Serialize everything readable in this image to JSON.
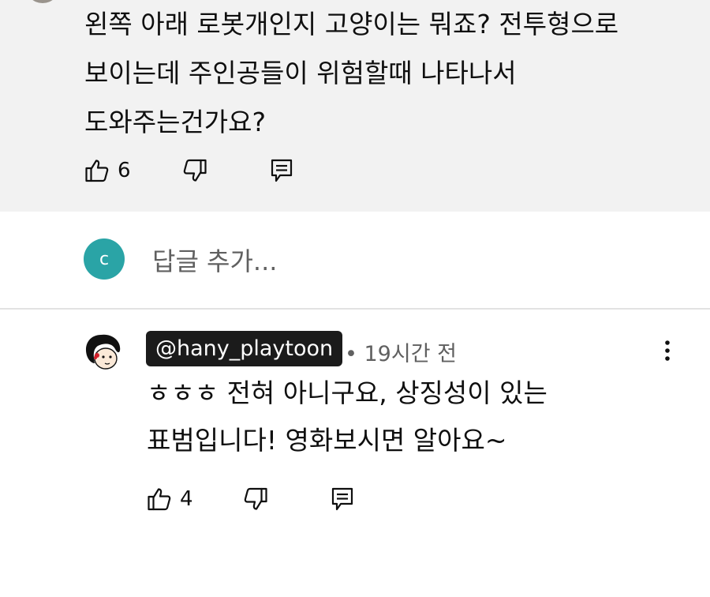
{
  "top_comment": {
    "text_lines": [
      "왼쪽 아래 로봇개인지 고양이는 뭐죠? 전투형으로",
      "보이는데 주인공들이 위험할때 나타나서",
      "도와주는건가요?"
    ],
    "like_count": "6"
  },
  "reply_input": {
    "avatar_letter": "c",
    "placeholder": "답글 추가..."
  },
  "reply": {
    "author": "@hany_playtoon",
    "meta": "• 19시간 전",
    "text_lines": [
      "ㅎㅎㅎ 전혀 아니구요, 상징성이 있는",
      "표범입니다! 영화보시면 알아요~"
    ],
    "like_count": "4"
  },
  "icons": {
    "like": "thumbs-up-icon",
    "dislike": "thumbs-down-icon",
    "reply": "comment-reply-icon",
    "more": "more-vertical-icon"
  },
  "colors": {
    "comment_bg": "#f2f2f2",
    "avatar_teal": "#2aa4a6",
    "badge_bg": "#1b1b1b",
    "secondary_text": "#606060"
  }
}
